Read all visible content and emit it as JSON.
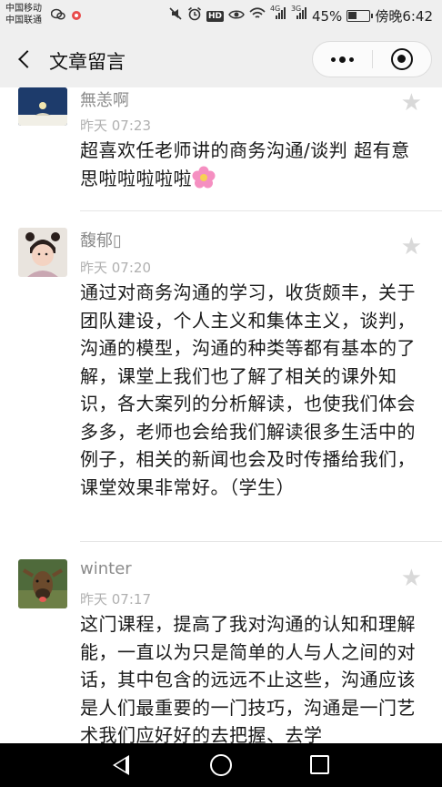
{
  "status_bar": {
    "carrier_1": "中国移动",
    "carrier_2": "中国联通",
    "signal_1": "4G",
    "signal_2": "3G",
    "battery": "45%",
    "battery_level": 0.45,
    "time": "傍晚6:42"
  },
  "nav": {
    "title": "文章留言"
  },
  "comments": [
    {
      "name": "無恙啊",
      "time": "昨天 07:23",
      "text": "超喜欢任老师讲的商务沟通/谈判 超有意思啦啦啦啦啦",
      "emoji": "flower-emoji"
    },
    {
      "name": "馥郁▯",
      "time": "昨天 07:20",
      "text": "通过对商务沟通的学习，收货颇丰，关于团队建设，个人主义和集体主义，谈判，沟通的模型，沟通的种类等都有基本的了解，课堂上我们也了解了相关的课外知识，各大案列的分析解读，也使我们体会多多，老师也会给我们解读很多生活中的例子，相关的新闻也会及时传播给我们，课堂效果非常好。（学生）"
    },
    {
      "name": "winter",
      "time": "昨天 07:17",
      "text": "这门课程，提高了我对沟通的认知和理解能，一直以为只是简单的人与人之间的对话，其中包含的远远不止这些，沟通应该是人们最重要的一门技巧，沟通是一门艺术我们应好好的去把握、去学"
    }
  ],
  "colors": {
    "header_bg": "#efefef",
    "meta_text": "#8c8c8c",
    "star": "#d9d9d9"
  }
}
